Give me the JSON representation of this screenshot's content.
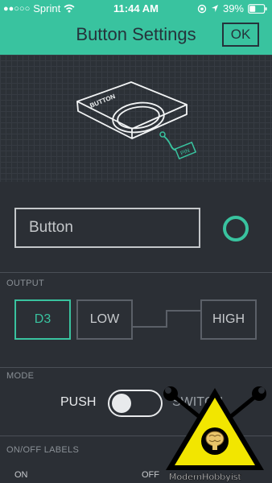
{
  "status_bar": {
    "carrier": "Sprint",
    "time": "11:44 AM",
    "battery": "39%"
  },
  "nav": {
    "title": "Button Settings",
    "ok_label": "OK"
  },
  "illustration": {
    "device_label": "BUTTON",
    "pin_label": "PIN"
  },
  "name_field": {
    "value": "Button"
  },
  "output": {
    "section_label": "OUTPUT",
    "pin": "D3",
    "low": "LOW",
    "high": "HIGH"
  },
  "mode": {
    "section_label": "MODE",
    "push_label": "PUSH",
    "switch_label": "SWITCH",
    "is_switch": false
  },
  "labels": {
    "section_label": "ON/OFF LABELS",
    "on": "ON",
    "off": "OFF"
  },
  "watermark": {
    "text": "ModernHobbyist"
  },
  "colors": {
    "accent": "#39c39f",
    "background": "#2b2f35",
    "watermark_yellow": "#f2e600"
  }
}
